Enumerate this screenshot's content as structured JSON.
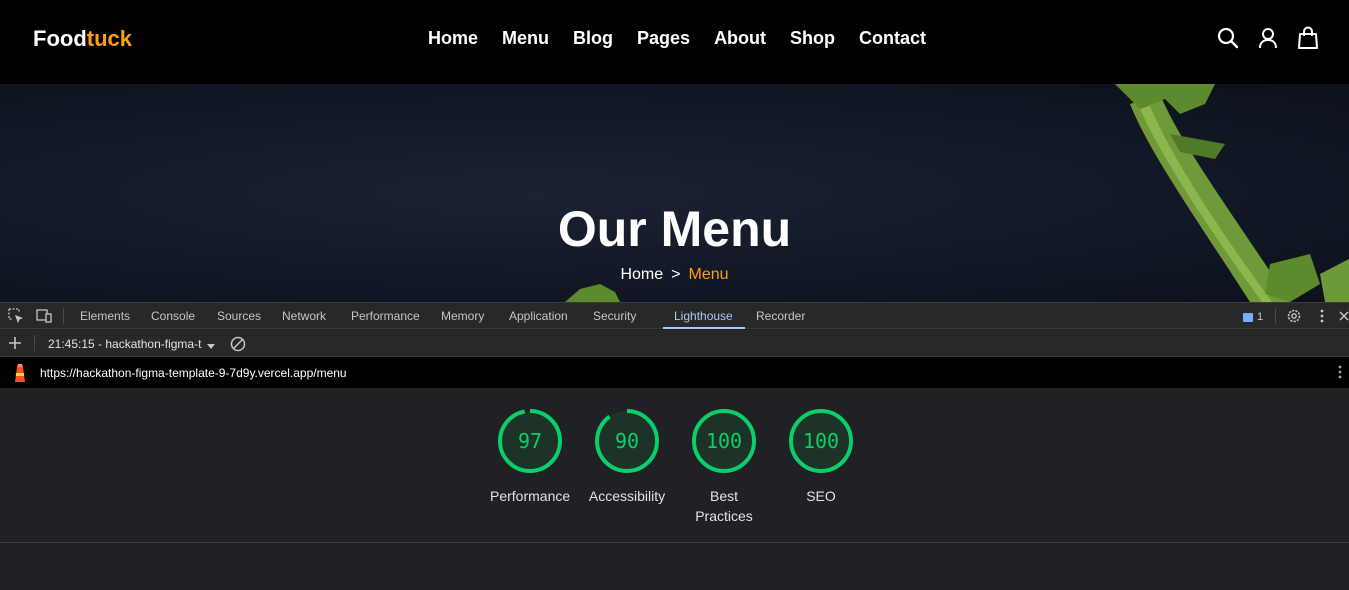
{
  "site": {
    "logo_primary": "Food",
    "logo_accent": "tuck",
    "nav": [
      "Home",
      "Menu",
      "Blog",
      "Pages",
      "About",
      "Shop",
      "Contact"
    ],
    "icons": [
      "search-icon",
      "user-icon",
      "shopping-bag-icon"
    ],
    "accent_color": "#ff9f0d"
  },
  "hero": {
    "title": "Our Menu",
    "breadcrumb_home": "Home",
    "breadcrumb_sep": ">",
    "breadcrumb_current": "Menu"
  },
  "devtools": {
    "tabs": [
      "Elements",
      "Console",
      "Sources",
      "Network",
      "Performance",
      "Memory",
      "Application",
      "Security",
      "Lighthouse",
      "Recorder"
    ],
    "active_tab": "Lighthouse",
    "issues_count": "1",
    "run_label": "21:45:15 - hackathon-figma-t",
    "url": "https://hackathon-figma-template-9-7d9y.vercel.app/menu",
    "scores": [
      {
        "value": 97,
        "label": "Performance"
      },
      {
        "value": 90,
        "label": "Accessibility"
      },
      {
        "value": 100,
        "label": "Best Practices"
      },
      {
        "value": 100,
        "label": "SEO"
      }
    ],
    "score_color": "#0cce6b"
  }
}
